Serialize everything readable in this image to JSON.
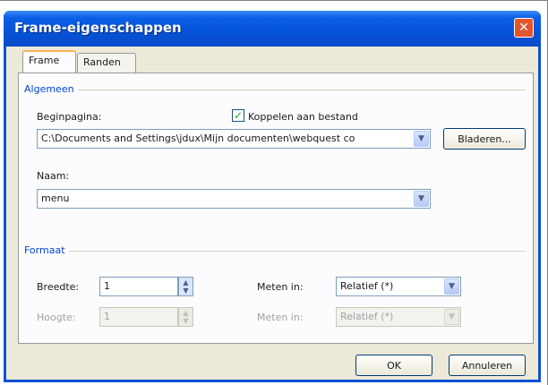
{
  "window": {
    "title": "Frame-eigenschappen"
  },
  "tabs": {
    "frame": "Frame",
    "randen": "Randen"
  },
  "algemeen": {
    "group_label": "Algemeen",
    "beginpagina_label": "Beginpagina:",
    "koppelen_label": "Koppelen aan bestand",
    "koppelen_checked": true,
    "beginpagina_value": "C:\\Documents and Settings\\jdux\\Mijn documenten\\webquest co",
    "bladeren_label": "Bladeren...",
    "naam_label": "Naam:",
    "naam_value": "menu"
  },
  "formaat": {
    "group_label": "Formaat",
    "breedte_label": "Breedte:",
    "breedte_value": "1",
    "meten_label_1": "Meten in:",
    "meten_value_1": "Relatief (*)",
    "hoogte_label": "Hoogte:",
    "hoogte_value": "1",
    "meten_label_2": "Meten in:",
    "meten_value_2": "Relatief (*)"
  },
  "buttons": {
    "ok": "OK",
    "annuleren": "Annuleren"
  }
}
